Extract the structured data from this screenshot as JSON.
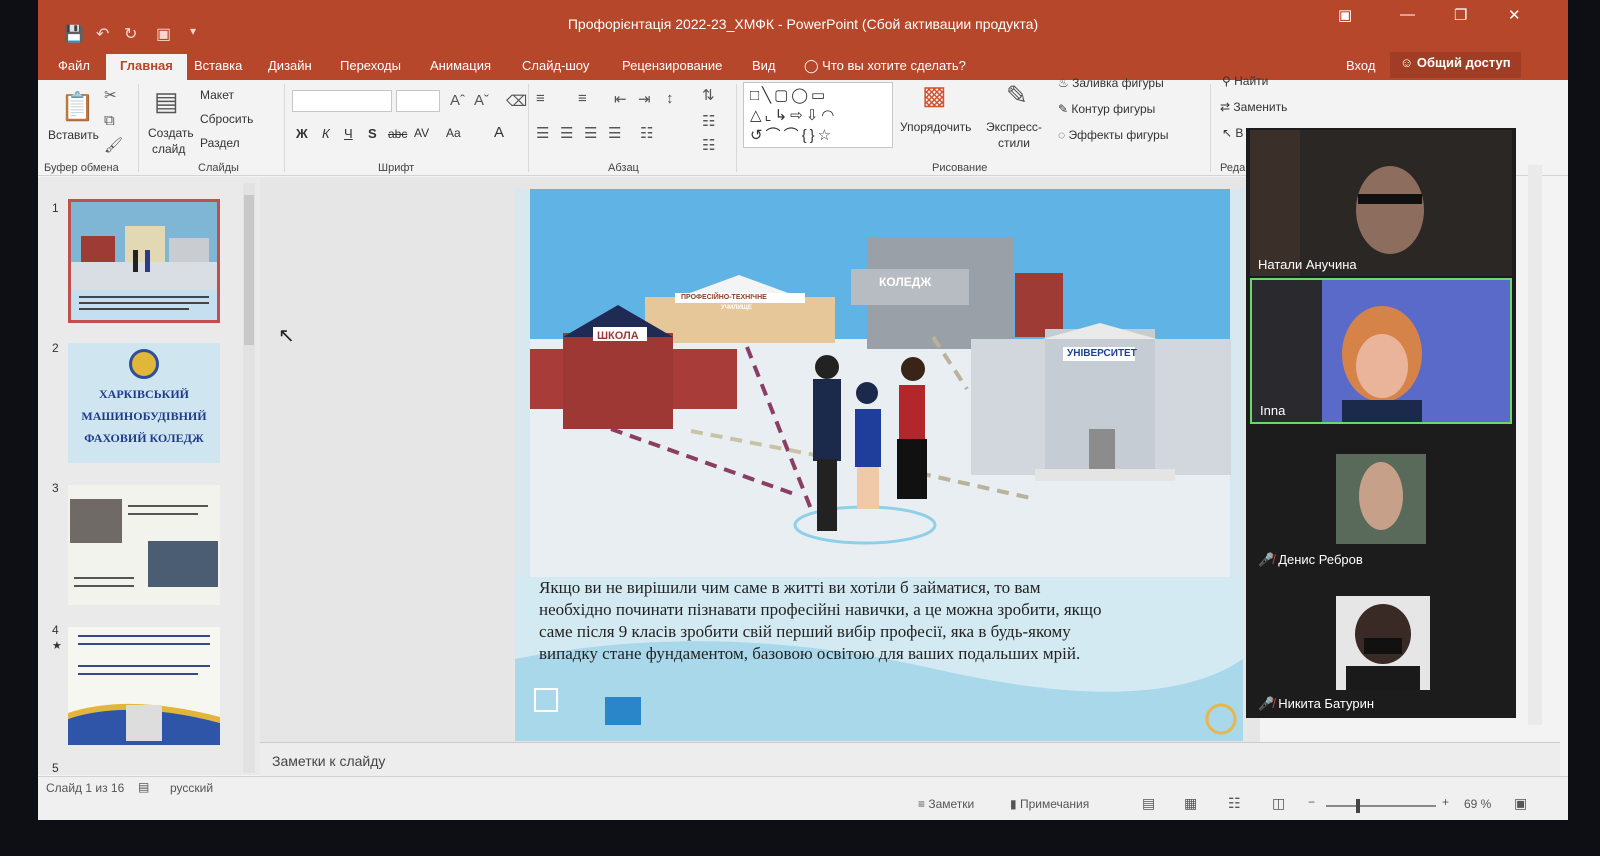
{
  "window": {
    "title": "Профорієнтація 2022-23_ХМФК - PowerPoint (Сбой активации продукта)",
    "sign_in": "Вход",
    "share": "Общий доступ"
  },
  "tabs": [
    "Файл",
    "Главная",
    "Вставка",
    "Дизайн",
    "Переходы",
    "Анимация",
    "Слайд-шоу",
    "Рецензирование",
    "Вид"
  ],
  "search": {
    "placeholder": "Что вы хотите сделать?"
  },
  "ribbon": {
    "clipboard": {
      "paste": "Вставить",
      "group": "Буфер обмена"
    },
    "slides": {
      "layout": "Макет",
      "reset": "Сбросить",
      "new_slide_1": "Создать",
      "new_slide_2": "слайд",
      "section": "Раздел",
      "group": "Слайды"
    },
    "font": {
      "group": "Шрифт",
      "bold": "Ж",
      "italic": "К",
      "underline": "Ч",
      "shadow": "S",
      "strike": "abc",
      "spacing": "AV",
      "case": "Aa",
      "color": "A"
    },
    "paragraph": {
      "group": "Абзац"
    },
    "drawing": {
      "arrange": "Упорядочить",
      "quick_styles_1": "Экспресс-",
      "quick_styles_2": "стили",
      "fill": "Заливка фигуры",
      "outline": "Контур фигуры",
      "effects": "Эффекты фигуры",
      "group": "Рисование"
    },
    "editing": {
      "find": "Найти",
      "replace": "Заменить",
      "select": "В",
      "group": "Реда"
    }
  },
  "slides_panel": {
    "numbers": [
      "1",
      "2",
      "3",
      "4",
      "5"
    ],
    "slide2_lines": [
      "ХАРКІВСЬКИЙ",
      "МАШИНОБУДІВНИЙ",
      "ФАХОВИЙ КОЛЕДЖ"
    ]
  },
  "slide": {
    "labels": {
      "school": "ШКОЛА",
      "vocational_1": "ПРОФЕСІЙНО-ТЕХНІЧНЕ",
      "vocational_2": "УЧИЛИЩЕ",
      "college": "КОЛЕДЖ",
      "university": "УНІВЕРСИТЕТ"
    },
    "text_lines": [
      "Якщо ви не вирішили чим саме в житті ви хотіли б займатися, то  вам",
      "необхідно починати пізнавати професійні навички, а це можна зробити, якщо",
      "саме після 9 класів зробити свій перший вибір професії, яка в будь-якому",
      "випадку стане фундаментом, базовою освітою для ваших  подальших мрій."
    ]
  },
  "notes": {
    "placeholder": "Заметки к слайду"
  },
  "status": {
    "slide_counter": "Слайд 1 из 16",
    "language": "русский",
    "notes": "Заметки",
    "comments": "Примечания",
    "zoom": "69 %"
  },
  "participants": [
    {
      "name": "Натали Анучина",
      "muted": false
    },
    {
      "name": "Inna",
      "muted": false
    },
    {
      "name": "Денис Ребров",
      "muted": true
    },
    {
      "name": "Никита Батурин",
      "muted": true
    }
  ],
  "colors": {
    "accent": "#b7472a",
    "active_speaker": "#6bd86b",
    "mute": "#e0433a"
  }
}
